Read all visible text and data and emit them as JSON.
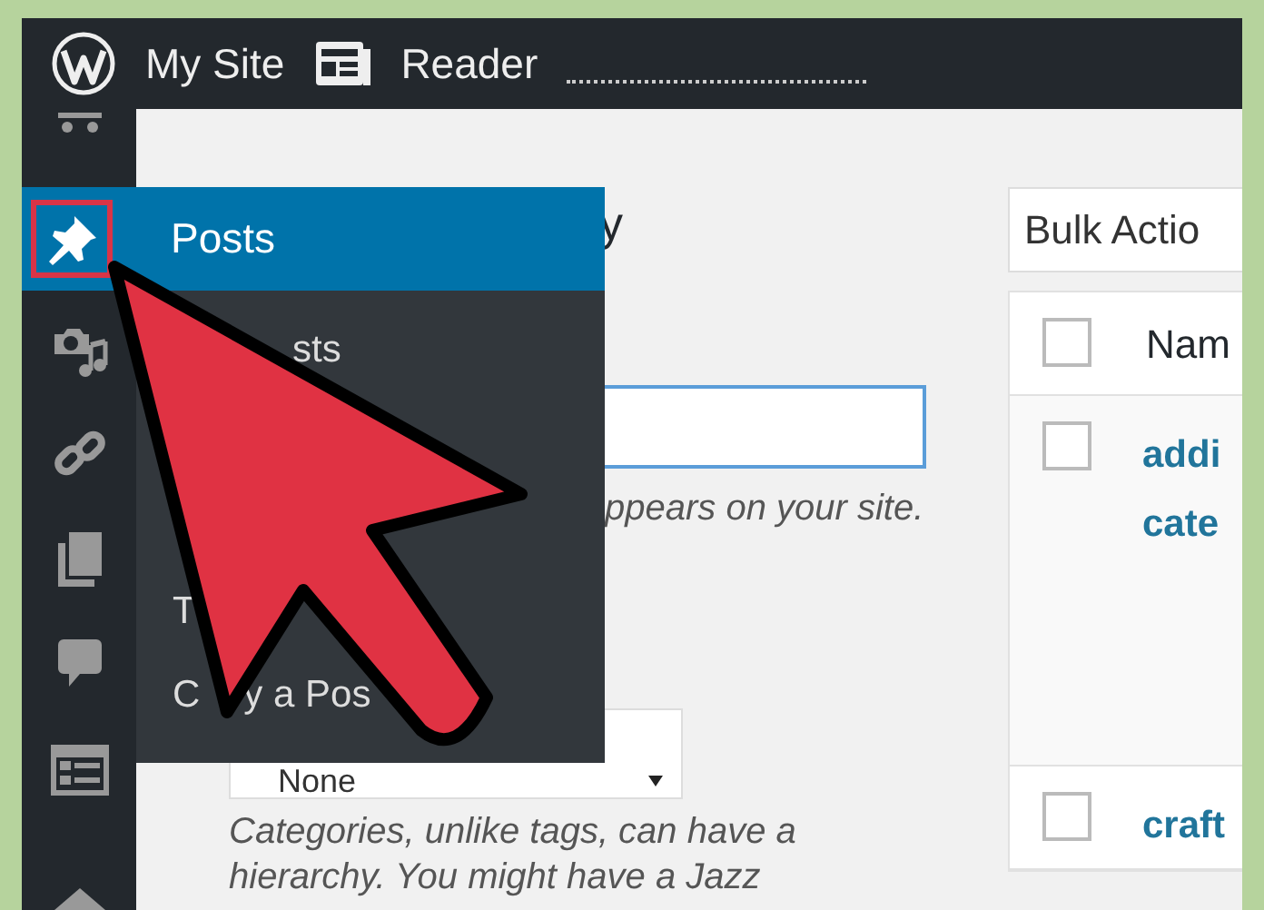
{
  "top_bar": {
    "items": [
      {
        "label": "My Site",
        "kind": "logo"
      },
      {
        "label": "Reader",
        "kind": "reader"
      }
    ]
  },
  "flyout": {
    "title": "Posts",
    "selected": true,
    "items": [
      {
        "segments": [
          "sts"
        ]
      },
      {
        "segments": [
          "T"
        ]
      },
      {
        "segments": [
          "C",
          "y a Pos"
        ]
      }
    ]
  },
  "form": {
    "heading": "y",
    "name_hint": "ppears on your site.",
    "parent_select": {
      "value": "None"
    },
    "parent_hint": "Categories, unlike tags, can have a hierarchy. You might have a Jazz"
  },
  "list": {
    "bulk_select": {
      "value": "Bulk Actio"
    },
    "header": {
      "label": "Nam",
      "checked": false
    },
    "rows": [
      {
        "name": "addi cate",
        "checked": false
      },
      {
        "name": "craft",
        "checked": false
      }
    ]
  }
}
